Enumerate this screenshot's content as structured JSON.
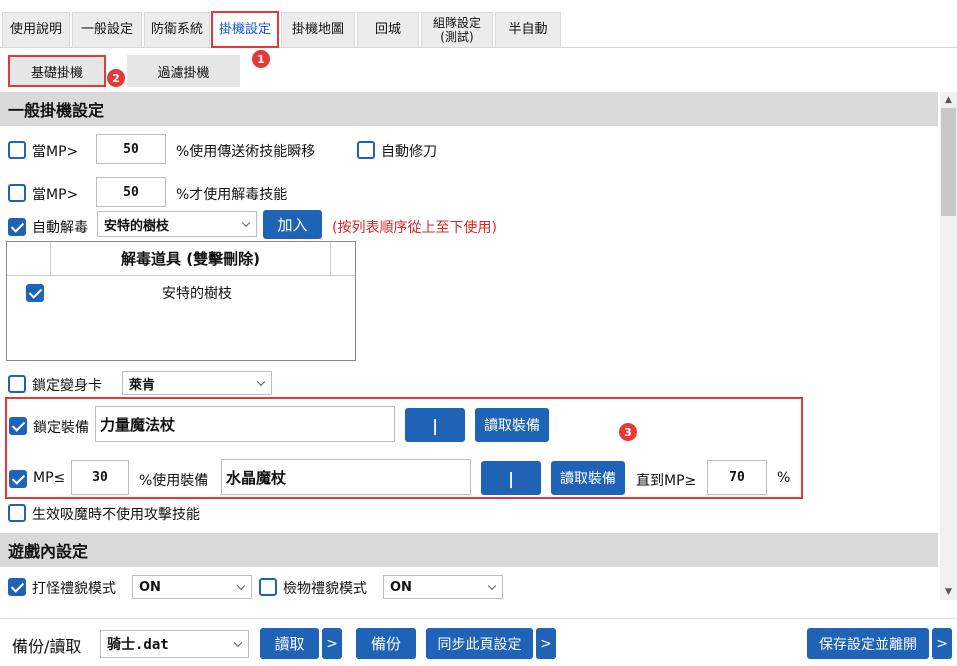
{
  "tabs": [
    {
      "label": "使用說明"
    },
    {
      "label": "一般設定"
    },
    {
      "label": "防衛系統"
    },
    {
      "label": "掛機設定"
    },
    {
      "label": "掛機地圖"
    },
    {
      "label": "回城"
    },
    {
      "label": "組隊設定\n(測試)"
    },
    {
      "label": "半自動"
    }
  ],
  "badges": {
    "one": "1",
    "two": "2",
    "three": "3"
  },
  "subtabs": [
    {
      "label": "基礎掛機"
    },
    {
      "label": "過濾掛機"
    }
  ],
  "section1": {
    "title": "一般掛機設定"
  },
  "row_tele": {
    "prefix": "當MP>",
    "value": "50",
    "suffix": "%使用傳送術技能瞬移",
    "auto_cut_label": "自動修刀"
  },
  "row_poison": {
    "prefix": "當MP>",
    "value": "50",
    "suffix": "%才使用解毒技能"
  },
  "row_autocure": {
    "label": "自動解毒",
    "select_value": "安特的樹枝",
    "add_button": "加入",
    "hint": "(按列表順序從上至下使用)"
  },
  "cure_table": {
    "header": "解毒道具 (雙擊刪除)",
    "rows": [
      {
        "name": "安特的樹枝"
      }
    ]
  },
  "row_morph": {
    "label": "鎖定變身卡",
    "select_value": "萊肯"
  },
  "row_lock_equip": {
    "label": "鎖定裝備",
    "value": "力量魔法杖",
    "pipe_button": "|",
    "read_button": "讀取裝備"
  },
  "row_mp_equip": {
    "prefix": "MP≤",
    "value": "30",
    "mid": "%使用裝備",
    "equip": "水晶魔杖",
    "pipe_button": "|",
    "read_button": "讀取裝備",
    "until": "直到MP≥",
    "until_value": "70",
    "pct": "%"
  },
  "row_no_attack": {
    "label": "生效吸魔時不使用攻擊技能"
  },
  "section2": {
    "title": "遊戲內設定"
  },
  "row_ingame": {
    "fight_label": "打怪禮貌模式",
    "fight_value": "ON",
    "pick_label": "檢物禮貌模式",
    "pick_value": "ON"
  },
  "footer": {
    "backup_label": "備份/讀取",
    "file_value": "骑士.dat",
    "read_button": "讀取",
    "arrow": ">",
    "backup_button": "備份",
    "sync_button": "同步此頁設定",
    "save_button": "保存設定並離開"
  },
  "colors": {
    "accent": "#1f63b6",
    "highlight": "#e03b3b",
    "active_tab_text": "#1a56d6"
  }
}
